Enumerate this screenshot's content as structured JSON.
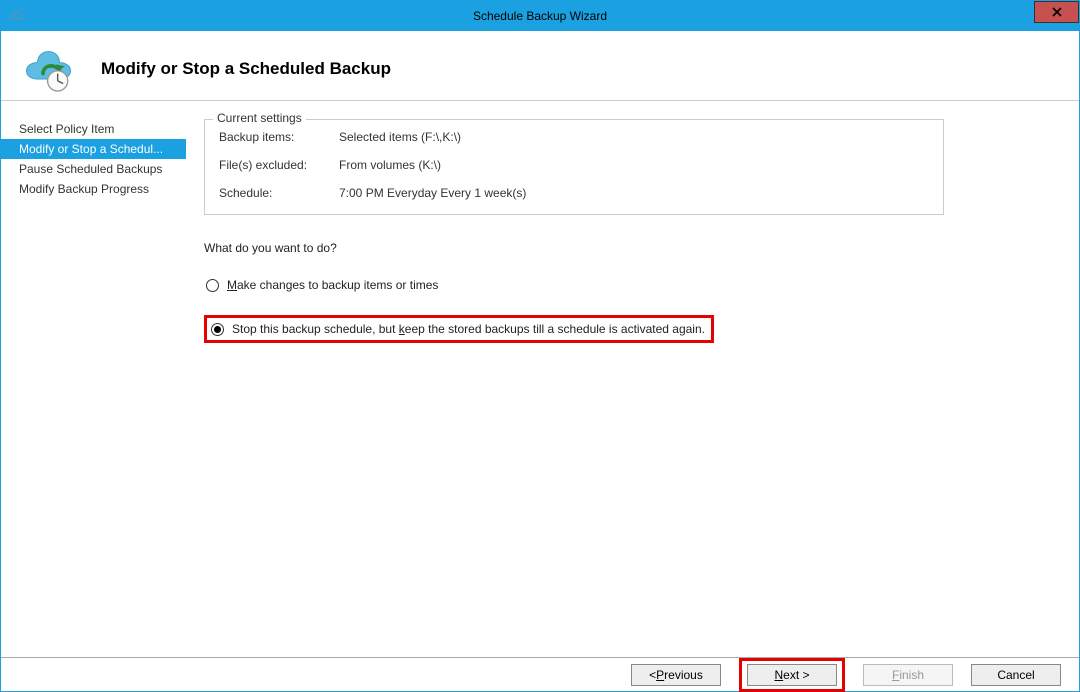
{
  "titlebar": {
    "title": "Schedule Backup Wizard",
    "close_label": "X"
  },
  "header": {
    "title": "Modify or Stop a Scheduled Backup"
  },
  "sidebar": {
    "items": [
      {
        "label": "Select Policy Item",
        "selected": false
      },
      {
        "label": "Modify or Stop a Schedul...",
        "selected": true
      },
      {
        "label": "Pause Scheduled Backups",
        "selected": false
      },
      {
        "label": "Modify Backup Progress",
        "selected": false
      }
    ]
  },
  "groupbox": {
    "title": "Current settings",
    "rows": [
      {
        "key": "Backup items:",
        "value": "Selected items (F:\\,K:\\)"
      },
      {
        "key": "File(s) excluded:",
        "value": "From volumes (K:\\)"
      },
      {
        "key": "Schedule:",
        "value": "7:00 PM Everyday Every 1 week(s)"
      }
    ]
  },
  "question": "What do you want to do?",
  "radios": [
    {
      "text_pre": "",
      "accel": "M",
      "text_post": "ake changes to backup items or times",
      "checked": false,
      "highlight": false
    },
    {
      "text_pre": "Stop this backup schedule, but ",
      "accel": "k",
      "text_post": "eep the stored backups till a schedule is activated again.",
      "checked": true,
      "highlight": true
    }
  ],
  "footer": {
    "previous_pre": "< ",
    "previous_accel": "P",
    "previous_post": "revious",
    "next_pre": "",
    "next_accel": "N",
    "next_post": "ext >",
    "finish_pre": "",
    "finish_accel": "F",
    "finish_post": "inish",
    "cancel": "Cancel",
    "next_highlight": true
  }
}
